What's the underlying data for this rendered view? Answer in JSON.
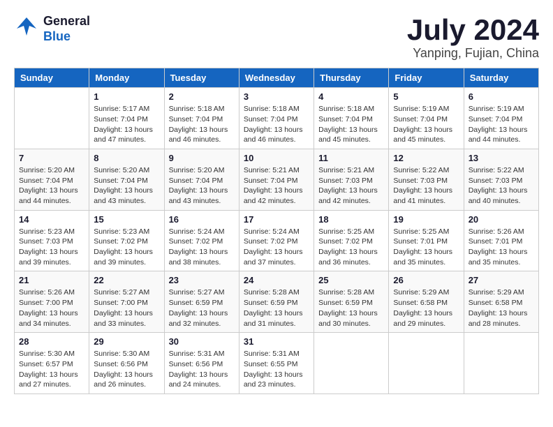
{
  "logo": {
    "general": "General",
    "blue": "Blue"
  },
  "title": {
    "month_year": "July 2024",
    "location": "Yanping, Fujian, China"
  },
  "headers": [
    "Sunday",
    "Monday",
    "Tuesday",
    "Wednesday",
    "Thursday",
    "Friday",
    "Saturday"
  ],
  "weeks": [
    [
      {
        "day": "",
        "info": ""
      },
      {
        "day": "1",
        "info": "Sunrise: 5:17 AM\nSunset: 7:04 PM\nDaylight: 13 hours\nand 47 minutes."
      },
      {
        "day": "2",
        "info": "Sunrise: 5:18 AM\nSunset: 7:04 PM\nDaylight: 13 hours\nand 46 minutes."
      },
      {
        "day": "3",
        "info": "Sunrise: 5:18 AM\nSunset: 7:04 PM\nDaylight: 13 hours\nand 46 minutes."
      },
      {
        "day": "4",
        "info": "Sunrise: 5:18 AM\nSunset: 7:04 PM\nDaylight: 13 hours\nand 45 minutes."
      },
      {
        "day": "5",
        "info": "Sunrise: 5:19 AM\nSunset: 7:04 PM\nDaylight: 13 hours\nand 45 minutes."
      },
      {
        "day": "6",
        "info": "Sunrise: 5:19 AM\nSunset: 7:04 PM\nDaylight: 13 hours\nand 44 minutes."
      }
    ],
    [
      {
        "day": "7",
        "info": "Sunrise: 5:20 AM\nSunset: 7:04 PM\nDaylight: 13 hours\nand 44 minutes."
      },
      {
        "day": "8",
        "info": "Sunrise: 5:20 AM\nSunset: 7:04 PM\nDaylight: 13 hours\nand 43 minutes."
      },
      {
        "day": "9",
        "info": "Sunrise: 5:20 AM\nSunset: 7:04 PM\nDaylight: 13 hours\nand 43 minutes."
      },
      {
        "day": "10",
        "info": "Sunrise: 5:21 AM\nSunset: 7:04 PM\nDaylight: 13 hours\nand 42 minutes."
      },
      {
        "day": "11",
        "info": "Sunrise: 5:21 AM\nSunset: 7:03 PM\nDaylight: 13 hours\nand 42 minutes."
      },
      {
        "day": "12",
        "info": "Sunrise: 5:22 AM\nSunset: 7:03 PM\nDaylight: 13 hours\nand 41 minutes."
      },
      {
        "day": "13",
        "info": "Sunrise: 5:22 AM\nSunset: 7:03 PM\nDaylight: 13 hours\nand 40 minutes."
      }
    ],
    [
      {
        "day": "14",
        "info": "Sunrise: 5:23 AM\nSunset: 7:03 PM\nDaylight: 13 hours\nand 39 minutes."
      },
      {
        "day": "15",
        "info": "Sunrise: 5:23 AM\nSunset: 7:02 PM\nDaylight: 13 hours\nand 39 minutes."
      },
      {
        "day": "16",
        "info": "Sunrise: 5:24 AM\nSunset: 7:02 PM\nDaylight: 13 hours\nand 38 minutes."
      },
      {
        "day": "17",
        "info": "Sunrise: 5:24 AM\nSunset: 7:02 PM\nDaylight: 13 hours\nand 37 minutes."
      },
      {
        "day": "18",
        "info": "Sunrise: 5:25 AM\nSunset: 7:02 PM\nDaylight: 13 hours\nand 36 minutes."
      },
      {
        "day": "19",
        "info": "Sunrise: 5:25 AM\nSunset: 7:01 PM\nDaylight: 13 hours\nand 35 minutes."
      },
      {
        "day": "20",
        "info": "Sunrise: 5:26 AM\nSunset: 7:01 PM\nDaylight: 13 hours\nand 35 minutes."
      }
    ],
    [
      {
        "day": "21",
        "info": "Sunrise: 5:26 AM\nSunset: 7:00 PM\nDaylight: 13 hours\nand 34 minutes."
      },
      {
        "day": "22",
        "info": "Sunrise: 5:27 AM\nSunset: 7:00 PM\nDaylight: 13 hours\nand 33 minutes."
      },
      {
        "day": "23",
        "info": "Sunrise: 5:27 AM\nSunset: 6:59 PM\nDaylight: 13 hours\nand 32 minutes."
      },
      {
        "day": "24",
        "info": "Sunrise: 5:28 AM\nSunset: 6:59 PM\nDaylight: 13 hours\nand 31 minutes."
      },
      {
        "day": "25",
        "info": "Sunrise: 5:28 AM\nSunset: 6:59 PM\nDaylight: 13 hours\nand 30 minutes."
      },
      {
        "day": "26",
        "info": "Sunrise: 5:29 AM\nSunset: 6:58 PM\nDaylight: 13 hours\nand 29 minutes."
      },
      {
        "day": "27",
        "info": "Sunrise: 5:29 AM\nSunset: 6:58 PM\nDaylight: 13 hours\nand 28 minutes."
      }
    ],
    [
      {
        "day": "28",
        "info": "Sunrise: 5:30 AM\nSunset: 6:57 PM\nDaylight: 13 hours\nand 27 minutes."
      },
      {
        "day": "29",
        "info": "Sunrise: 5:30 AM\nSunset: 6:56 PM\nDaylight: 13 hours\nand 26 minutes."
      },
      {
        "day": "30",
        "info": "Sunrise: 5:31 AM\nSunset: 6:56 PM\nDaylight: 13 hours\nand 24 minutes."
      },
      {
        "day": "31",
        "info": "Sunrise: 5:31 AM\nSunset: 6:55 PM\nDaylight: 13 hours\nand 23 minutes."
      },
      {
        "day": "",
        "info": ""
      },
      {
        "day": "",
        "info": ""
      },
      {
        "day": "",
        "info": ""
      }
    ]
  ]
}
